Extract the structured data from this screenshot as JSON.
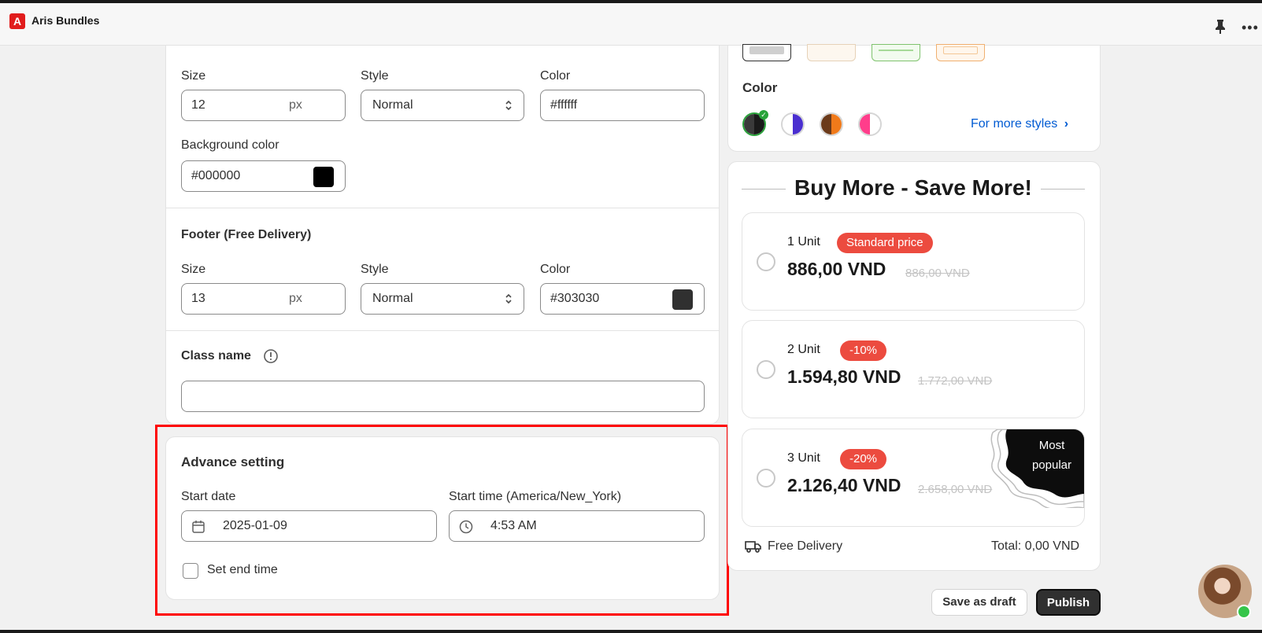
{
  "app": {
    "title": "Aris Bundles",
    "logo_letter": "A"
  },
  "text_section": {
    "size_label": "Size",
    "style_label": "Style",
    "color_label": "Color",
    "size_value": "12",
    "size_unit": "px",
    "style_value": "Normal",
    "color_value": "#ffffff",
    "bg_label": "Background color",
    "bg_value": "#000000"
  },
  "footer_section": {
    "title": "Footer (Free Delivery)",
    "size_label": "Size",
    "style_label": "Style",
    "color_label": "Color",
    "size_value": "13",
    "size_unit": "px",
    "style_value": "Normal",
    "color_value": "#303030"
  },
  "class_section": {
    "title": "Class name",
    "value": ""
  },
  "advance": {
    "title": "Advance setting",
    "start_date_label": "Start date",
    "start_date_value": "2025-01-09",
    "start_time_label": "Start time (America/New_York)",
    "start_time_value": "4:53 AM",
    "end_time_label": "Set end time",
    "end_time_checked": false
  },
  "style_panel": {
    "color_label": "Color",
    "more_styles": "For more styles",
    "swatches": [
      {
        "name": "dark",
        "left": "#303030",
        "right": "#1a1a1a",
        "selected": true
      },
      {
        "name": "purple",
        "left": "#ffffff",
        "right": "#4a2fd0",
        "selected": false
      },
      {
        "name": "orange",
        "left": "#6b3a1a",
        "right": "#f07a1a",
        "selected": false
      },
      {
        "name": "pink",
        "left": "#ff3d8b",
        "right": "#ffffff",
        "selected": false
      }
    ]
  },
  "preview": {
    "heading": "Buy More - Save More!",
    "offers": [
      {
        "units": "1 Unit",
        "badge": "Standard price",
        "price": "886,00 VND",
        "old_price": "886,00 VND"
      },
      {
        "units": "2 Unit",
        "badge": "-10%",
        "price": "1.594,80 VND",
        "old_price": "1.772,00 VND"
      },
      {
        "units": "3 Unit",
        "badge": "-20%",
        "price": "2.126,40 VND",
        "old_price": "2.658,00 VND",
        "ribbon": "Most popular"
      }
    ],
    "free_delivery": "Free Delivery",
    "total": "Total: 0,00 VND"
  },
  "actions": {
    "save_draft": "Save as draft",
    "publish": "Publish"
  },
  "colors": {
    "accent_red": "#ec4b3f",
    "link_blue": "#005bd3",
    "highlight": "#ff0000"
  }
}
